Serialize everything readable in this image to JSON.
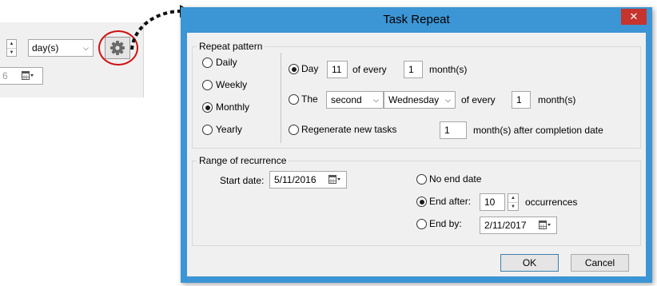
{
  "background": {
    "unit_select": "day(s)",
    "date_partial": "6",
    "gear_icon": "gear-icon"
  },
  "dialog": {
    "title": "Task Repeat",
    "close_glyph": "✕",
    "repeat_pattern": {
      "group_label": "Repeat pattern",
      "options": [
        "Daily",
        "Weekly",
        "Monthly",
        "Yearly"
      ],
      "selected": "Monthly",
      "day_row": {
        "label": "Day",
        "day_value": "11",
        "of_every": "of every",
        "months_value": "1",
        "months_label": "month(s)"
      },
      "the_row": {
        "label": "The",
        "ordinal": "second",
        "weekday": "Wednesday",
        "of_every": "of every",
        "months_value": "1",
        "months_label": "month(s)"
      },
      "regen_row": {
        "label": "Regenerate new tasks",
        "months_value": "1",
        "after_label": "month(s) after completion date"
      },
      "monthly_selected": "Day"
    },
    "range": {
      "group_label": "Range of recurrence",
      "start_label": "Start date:",
      "start_value": "5/11/2016",
      "no_end_label": "No end date",
      "end_after_label": "End after:",
      "end_after_value": "10",
      "occurrences_label": "occurrences",
      "end_by_label": "End by:",
      "end_by_value": "2/11/2017",
      "selected": "End after"
    },
    "buttons": {
      "ok": "OK",
      "cancel": "Cancel"
    }
  },
  "colors": {
    "title_bar": "#3c95d4",
    "close_button": "#c6342e",
    "callout_circle": "#d01010",
    "client_bg": "#f0f0f0"
  }
}
